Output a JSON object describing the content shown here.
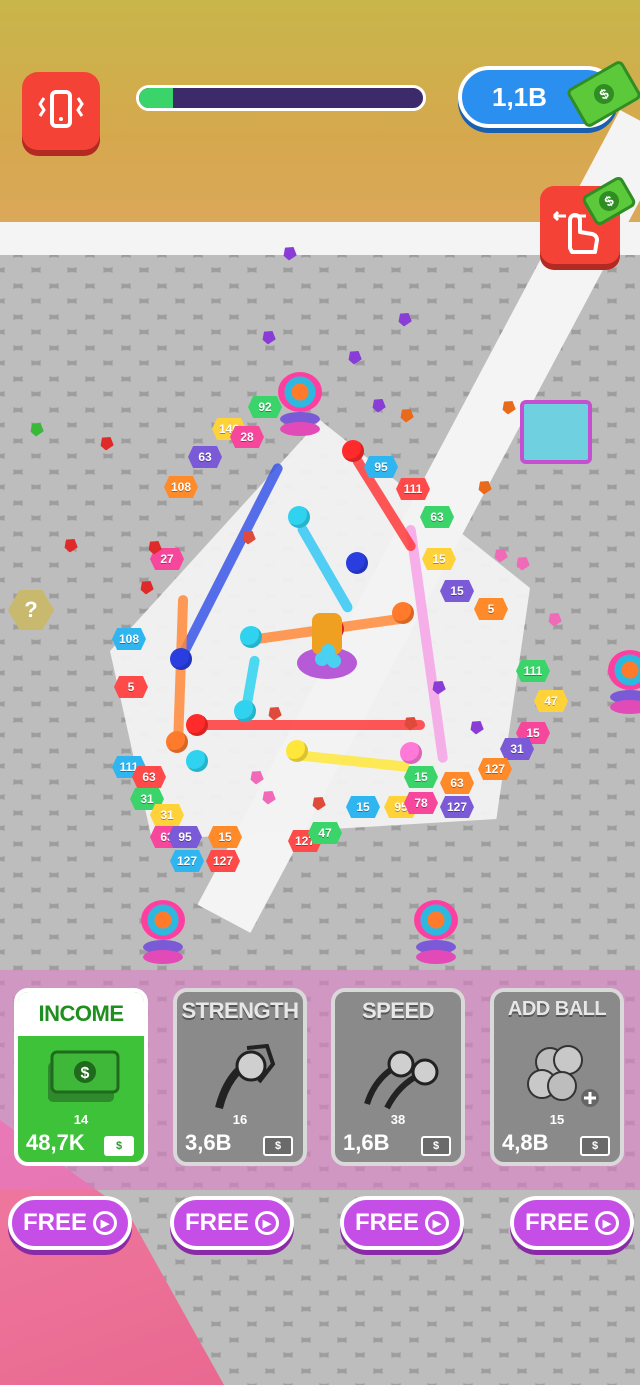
{
  "hud": {
    "vibration_icon": "phone-vibrate-icon",
    "level_progress": 0.12,
    "money": "1,1B",
    "money_icon": "cash-stack-icon",
    "gesture_icon": "tap-swipe-hand-icon"
  },
  "field": {
    "hex_numbers": [
      "92",
      "146",
      "28",
      "63",
      "108",
      "95",
      "111",
      "63",
      "15",
      "27",
      "15",
      "5",
      "108",
      "5",
      "111",
      "47",
      "15",
      "31",
      "127",
      "111",
      "63",
      "31",
      "31",
      "63",
      "95",
      "15",
      "127",
      "127",
      "15",
      "95",
      "78",
      "127",
      "63",
      "15",
      "127",
      "47"
    ],
    "mystery_label": "?"
  },
  "upgrades": [
    {
      "title": "INCOME",
      "level": "14",
      "price": "48,7K",
      "active": true,
      "icon": "cash-stack-icon"
    },
    {
      "title": "STRENGTH",
      "level": "16",
      "price": "3,6B",
      "active": false,
      "icon": "strength-balls-icon"
    },
    {
      "title": "SPEED",
      "level": "38",
      "price": "1,6B",
      "active": false,
      "icon": "speed-balls-icon"
    },
    {
      "title": "ADD BALL",
      "level": "15",
      "price": "4,8B",
      "active": false,
      "icon": "add-ball-icon"
    }
  ],
  "free_buttons": [
    "FREE",
    "FREE",
    "FREE",
    "FREE"
  ],
  "colors": {
    "hud_red": "#f44336",
    "progress_fill": "#3ad46a",
    "money_blue": "#2b8ff0",
    "free_purple": "#c54ee6",
    "income_green": "#3ec23a"
  }
}
